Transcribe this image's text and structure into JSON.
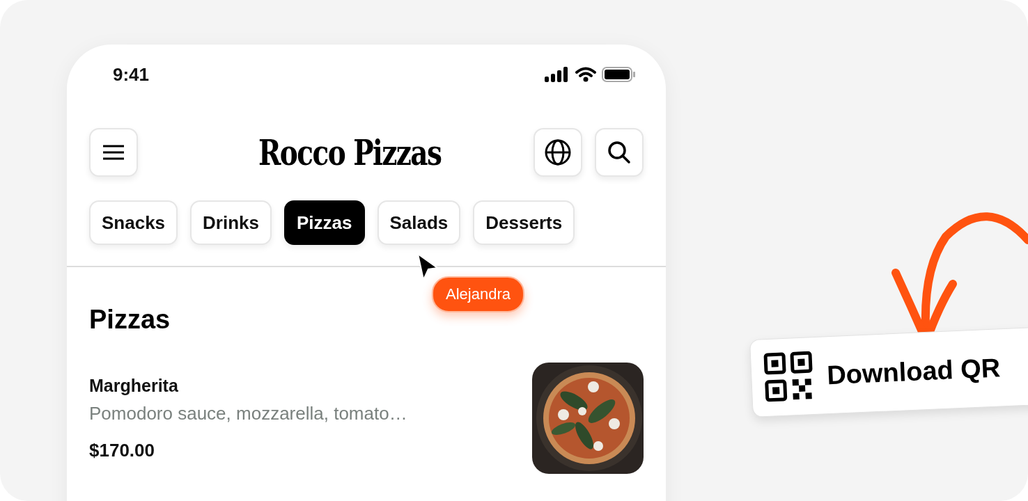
{
  "status_bar": {
    "time": "9:41"
  },
  "header": {
    "title": "Rocco Pizzas"
  },
  "categories": [
    {
      "label": "Snacks",
      "selected": false
    },
    {
      "label": "Drinks",
      "selected": false
    },
    {
      "label": "Pizzas",
      "selected": true
    },
    {
      "label": "Salads",
      "selected": false
    },
    {
      "label": "Desserts",
      "selected": false
    }
  ],
  "cursor": {
    "name": "Alejandra"
  },
  "section": {
    "title": "Pizzas"
  },
  "items": [
    {
      "name": "Margherita",
      "description": "Pomodoro sauce, mozzarella, tomato…",
      "price": "$170.00"
    }
  ],
  "download": {
    "label": "Download QR"
  }
}
